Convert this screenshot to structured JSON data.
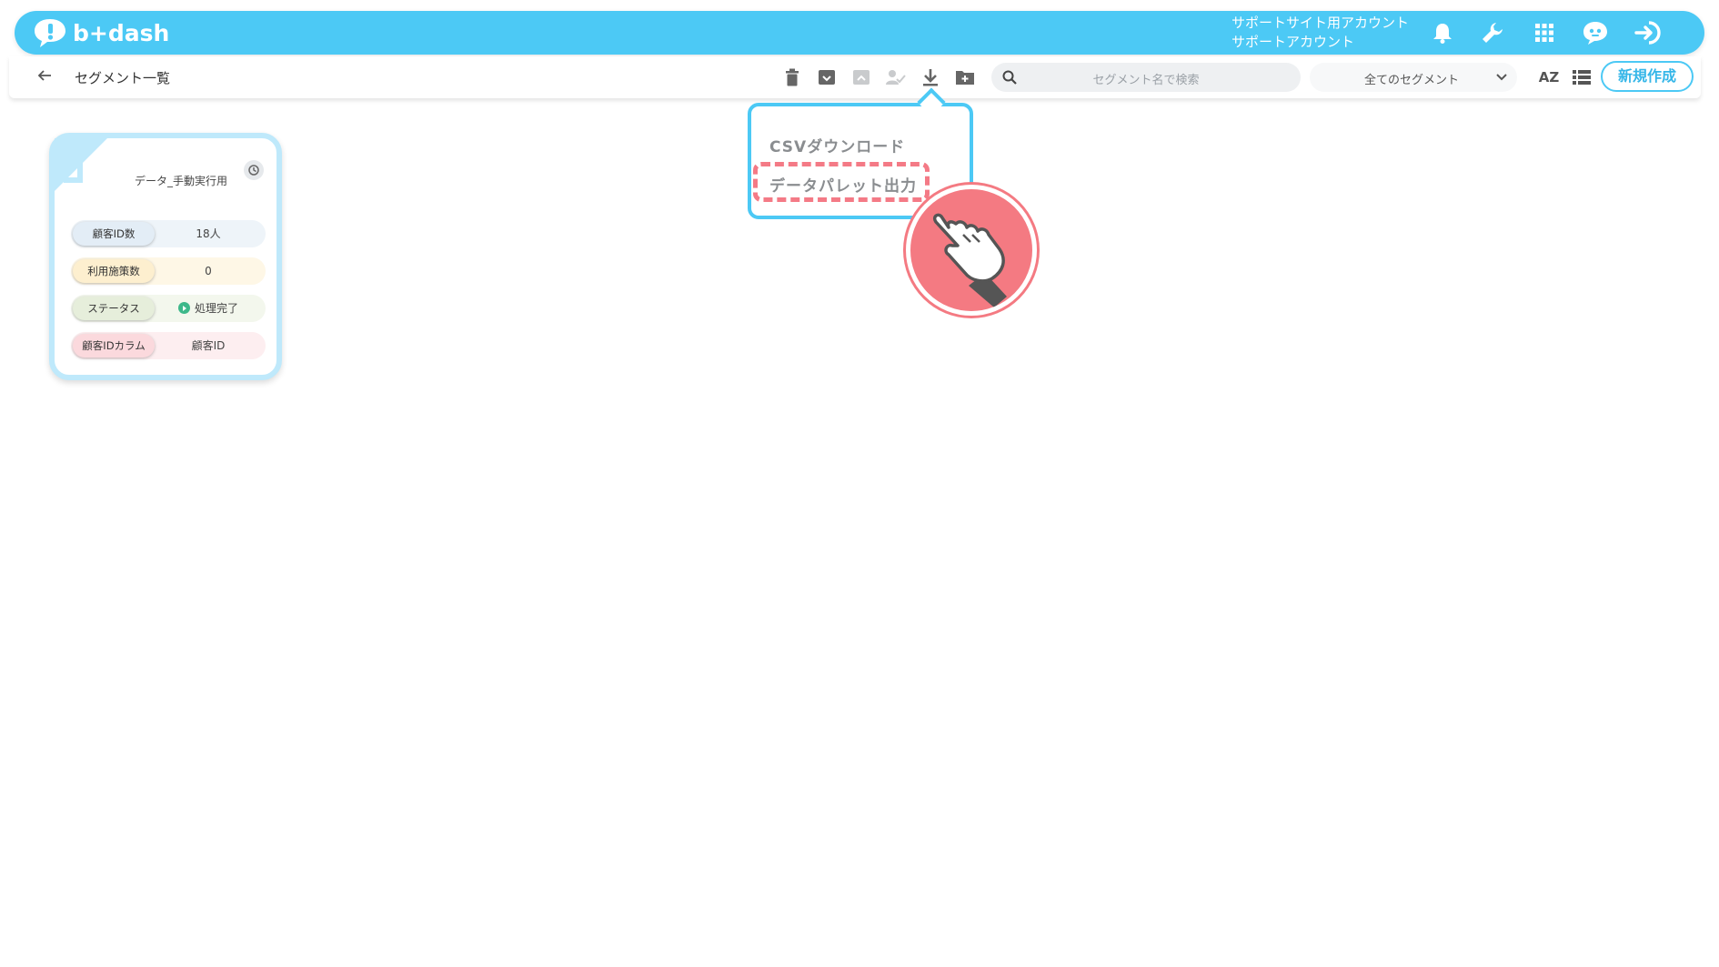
{
  "header": {
    "brand": "b+dash",
    "account_line1": "サポートサイト用アカウント",
    "account_line2": "サポートアカウント",
    "icons": [
      "bell-icon",
      "wrench-icon",
      "grid-icon",
      "chat-bot-icon",
      "logout-icon"
    ]
  },
  "subbar": {
    "title": "セグメント一覧",
    "search_placeholder": "セグメント名で検索",
    "filter_value": "全てのセグメント",
    "sort_label": "AZ",
    "new_button": "新規作成"
  },
  "card": {
    "title": "データ_手動実行用",
    "rows": [
      {
        "key": "顧客ID数",
        "value": "18人",
        "color": "#e9f1f8"
      },
      {
        "key": "利用施策数",
        "value": "0",
        "color": "#fdf3de"
      },
      {
        "key": "ステータス",
        "value": "処理完了",
        "color": "#eef3e6"
      },
      {
        "key": "顧客IDカラム",
        "value": "顧客ID",
        "color": "#fde6e8"
      }
    ]
  },
  "dropdown": {
    "items": [
      "CSVダウンロード",
      "データパレット出力"
    ]
  },
  "colors": {
    "brand": "#4cc9f5",
    "highlight": "#f47a86"
  }
}
